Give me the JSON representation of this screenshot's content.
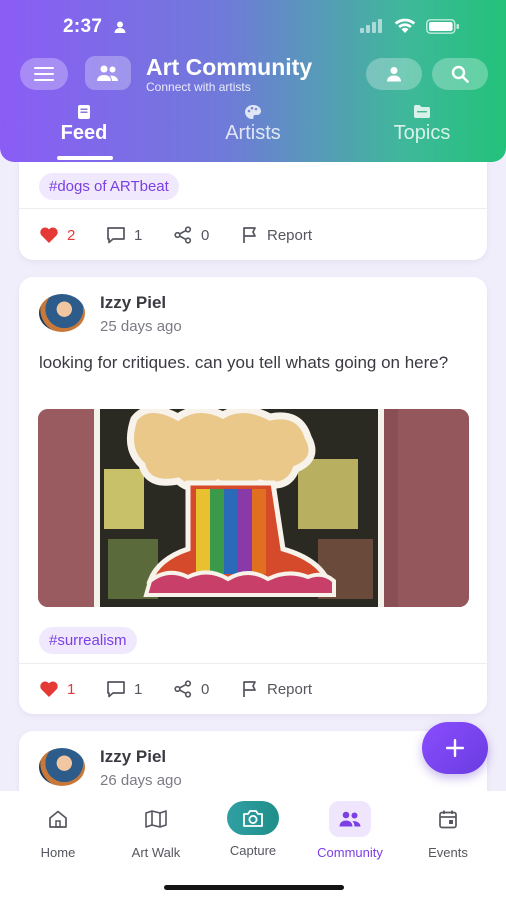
{
  "status_bar": {
    "time": "2:37"
  },
  "header": {
    "title": "Art Community",
    "subtitle": "Connect with artists",
    "tabs": [
      {
        "label": "Feed",
        "active": true
      },
      {
        "label": "Artists",
        "active": false
      },
      {
        "label": "Topics",
        "active": false
      }
    ]
  },
  "posts": [
    {
      "tag": "#dogs of ARTbeat",
      "likes": "2",
      "comments": "1",
      "shares": "0",
      "report_label": "Report"
    },
    {
      "author": "Izzy Piel",
      "time": "25 days ago",
      "text": "looking for critiques. can you tell whats going on here?",
      "tag": "#surrealism",
      "likes": "1",
      "comments": "1",
      "shares": "0",
      "report_label": "Report"
    },
    {
      "author": "Izzy Piel",
      "time": "26 days ago"
    }
  ],
  "bottom_nav": [
    {
      "label": "Home",
      "icon": "home-icon"
    },
    {
      "label": "Art Walk",
      "icon": "map-icon"
    },
    {
      "label": "Capture",
      "icon": "camera-icon"
    },
    {
      "label": "Community",
      "icon": "group-icon",
      "active": true
    },
    {
      "label": "Events",
      "icon": "calendar-icon"
    }
  ],
  "colors": {
    "accent": "#7b3fe4",
    "header_start": "#8b5cf6",
    "header_end": "#22c27a",
    "like": "#e53935"
  }
}
